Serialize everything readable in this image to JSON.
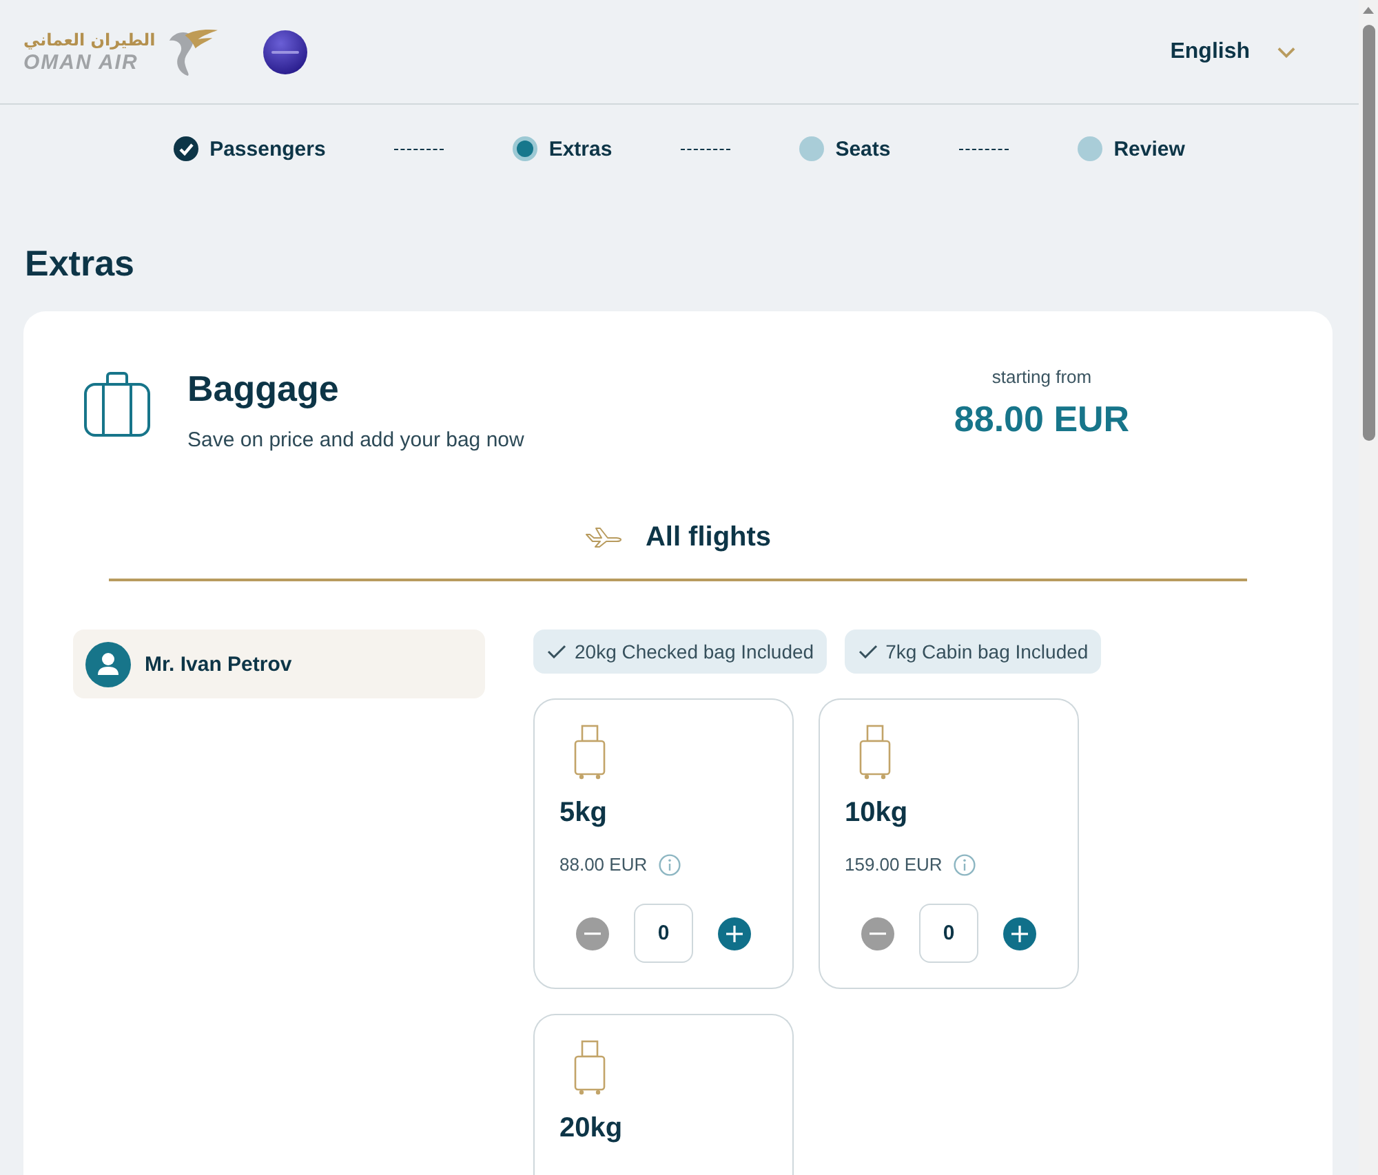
{
  "header": {
    "logo": {
      "arabic": "الطيران العماني",
      "latin": "OMAN AIR"
    },
    "language": "English"
  },
  "stepper": [
    {
      "label": "Passengers",
      "completed": true,
      "selected": false
    },
    {
      "label": "Extras",
      "completed": false,
      "selected": true
    },
    {
      "label": "Seats",
      "completed": false,
      "selected": false
    },
    {
      "label": "Review",
      "completed": false,
      "selected": false
    }
  ],
  "page_title": "Extras",
  "baggage": {
    "title": "Baggage",
    "subtitle": "Save on price and add your bag now",
    "price_caption": "starting from",
    "price": "88.00 EUR"
  },
  "flight_tabs": [
    {
      "label": "All flights",
      "selected": true
    }
  ],
  "passengers": [
    {
      "name": "Mr. Ivan Petrov",
      "selected": true
    }
  ],
  "included": [
    "20kg Checked bag Included",
    "7kg Cabin bag Included"
  ],
  "options": [
    {
      "weight": "5kg",
      "price": "88.00 EUR",
      "quantity": "0",
      "decrease_disabled": true,
      "increase_disabled": false
    },
    {
      "weight": "10kg",
      "price": "159.00 EUR",
      "quantity": "0",
      "decrease_disabled": true,
      "increase_disabled": false
    },
    {
      "weight": "20kg"
    }
  ]
}
